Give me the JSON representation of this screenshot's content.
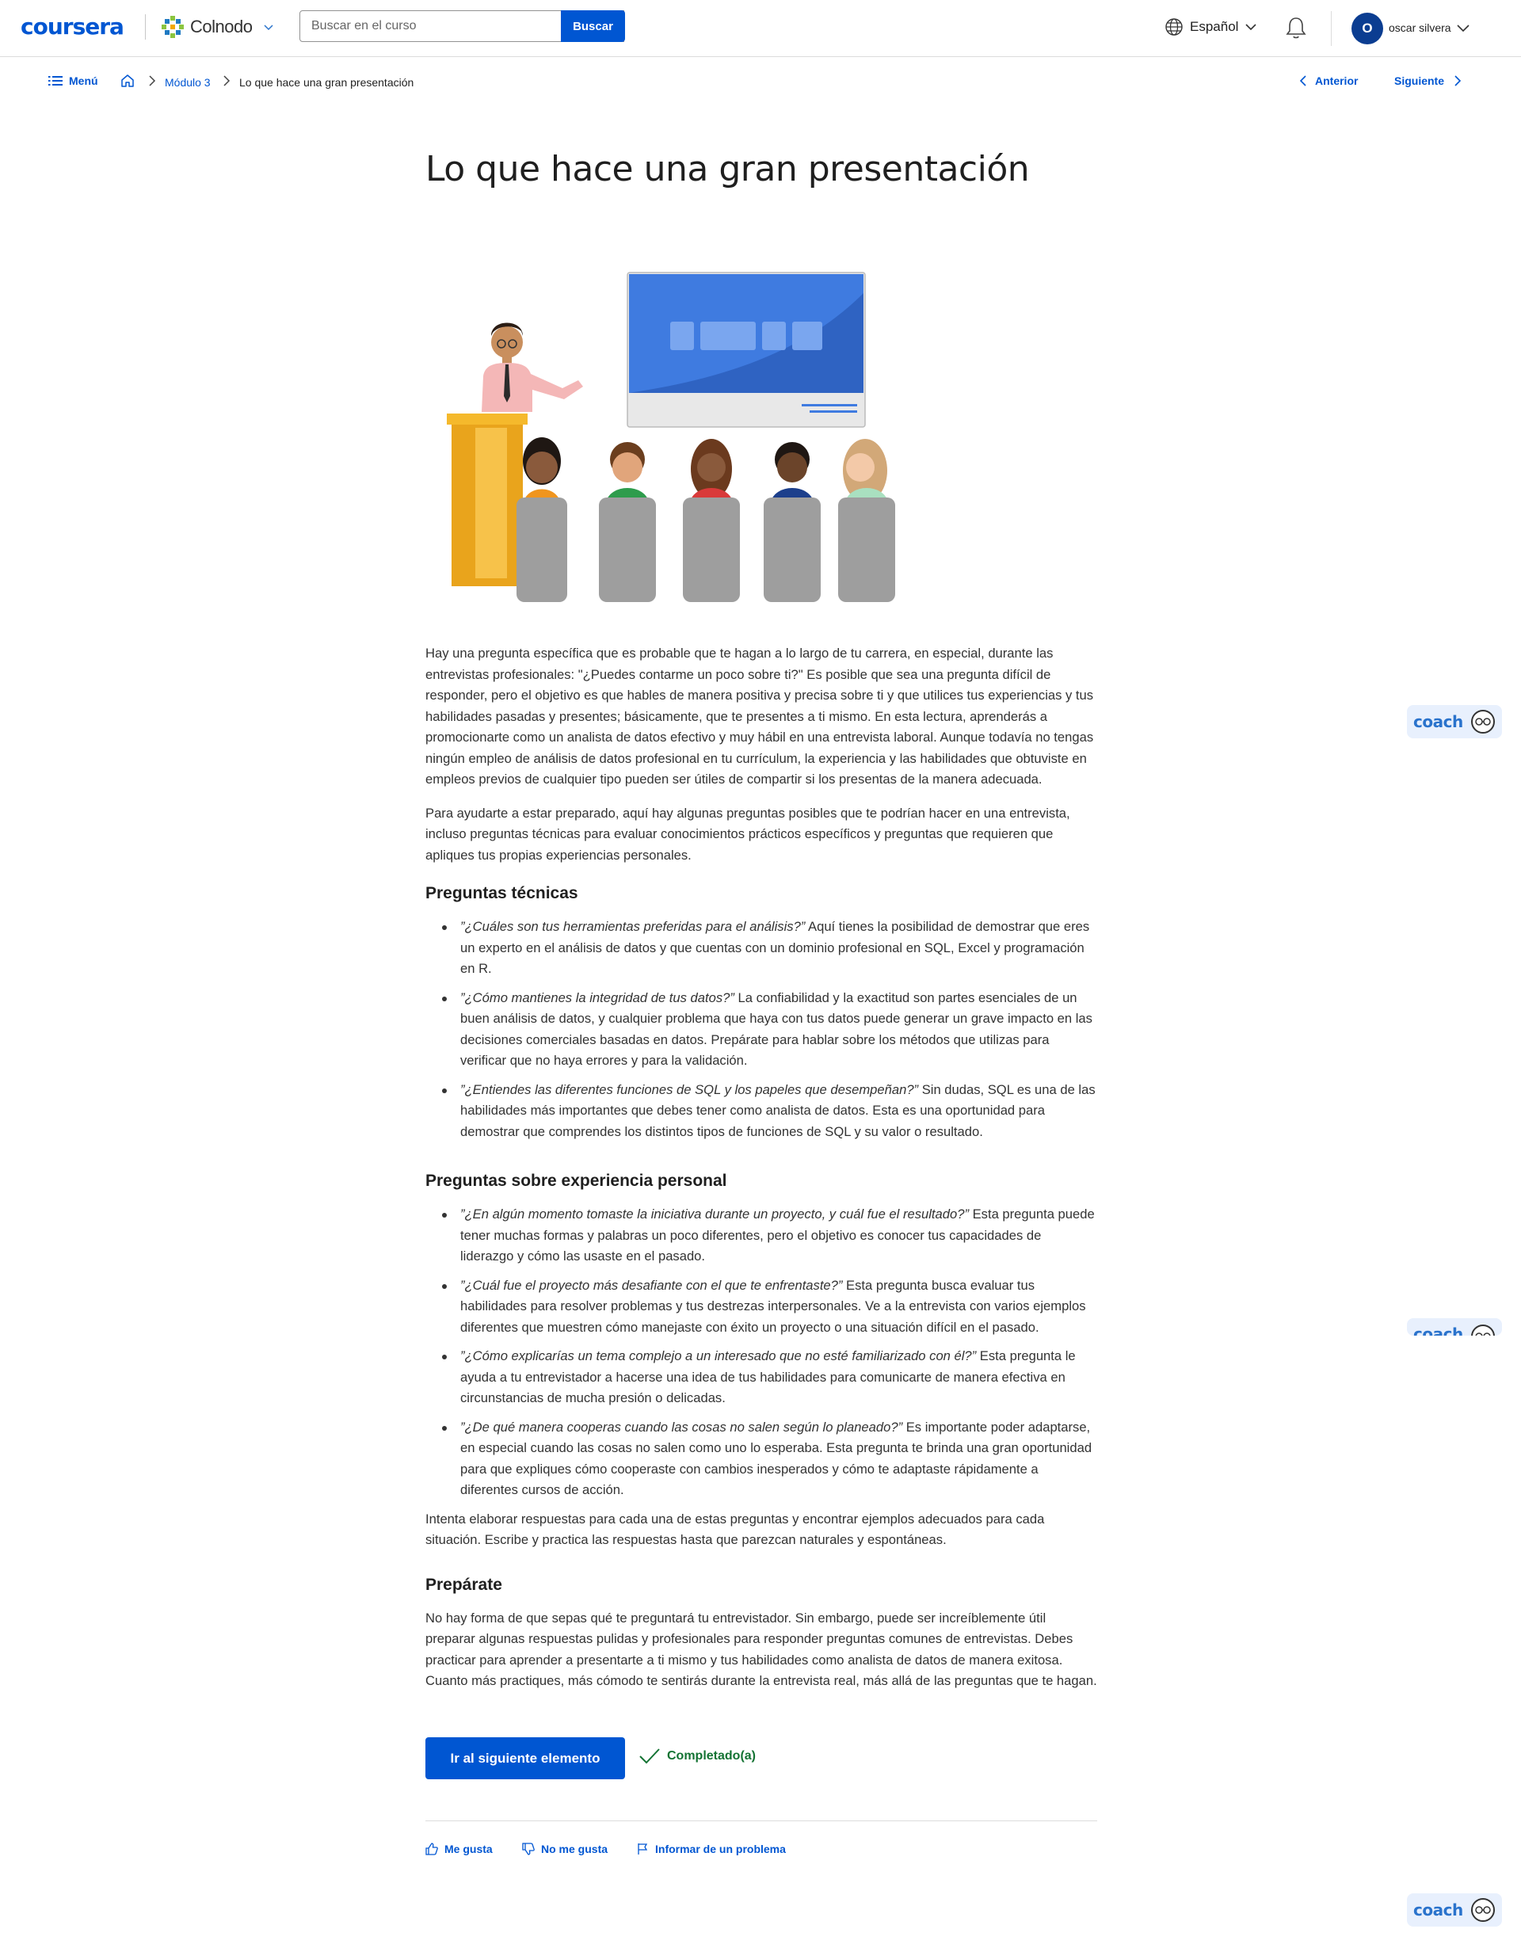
{
  "header": {
    "logo": "coursera",
    "partner": "Colnodo",
    "search_placeholder": "Buscar en el curso",
    "search_button": "Buscar",
    "language": "Español",
    "avatar_initial": "O",
    "username": "oscar silvera"
  },
  "breadcrumb": {
    "menu": "Menú",
    "module": "Módulo 3",
    "current": "Lo que hace una gran presentación",
    "prev": "Anterior",
    "next": "Siguiente"
  },
  "page": {
    "title": "Lo que hace una gran presentación",
    "intro_1": "Hay una pregunta específica que es probable que te hagan a lo largo de tu carrera, en especial, durante las entrevistas profesionales: \"¿Puedes contarme un poco sobre ti?\" Es posible que sea una pregunta difícil de responder, pero el objetivo es que hables de manera positiva y precisa sobre ti y que utilices tus experiencias y tus habilidades pasadas y presentes; básicamente, que te presentes a ti mismo. En esta lectura, aprenderás a promocionarte como un analista de datos efectivo y muy hábil en una entrevista laboral. Aunque todavía no tengas ningún empleo de análisis de datos profesional en tu currículum, la experiencia y las habilidades que obtuviste en empleos previos de cualquier tipo pueden ser útiles de compartir si los presentas de la manera adecuada.",
    "intro_2": "Para ayudarte a estar preparado, aquí hay algunas preguntas posibles que te podrían hacer en una entrevista, incluso preguntas técnicas para evaluar conocimientos prácticos específicos y preguntas que requieren que apliques tus propias experiencias personales.",
    "h_tech": "Preguntas técnicas",
    "tech": [
      {
        "q": "”¿Cuáles son tus herramientas preferidas para el análisis?”",
        "a": " Aquí tienes la posibilidad de demostrar que eres un experto en el análisis de datos y que cuentas con un dominio profesional en SQL, Excel y programación en R."
      },
      {
        "q": "”¿Cómo mantienes la integridad de tus datos?”",
        "a": " La confiabilidad y la exactitud son partes esenciales de un buen análisis de datos, y cualquier problema que haya con tus datos puede generar un grave impacto en las decisiones comerciales basadas en datos. Prepárate para hablar sobre los métodos que utilizas para verificar que no haya errores y para la validación."
      },
      {
        "q": "”¿Entiendes las diferentes funciones de SQL y los papeles que desempeñan?”",
        "a": " Sin dudas, SQL es una de las habilidades más importantes que debes tener como analista de datos. Esta es una oportunidad para demostrar que comprendes los distintos tipos de funciones de SQL y su valor o resultado."
      }
    ],
    "h_personal": "Preguntas sobre experiencia personal",
    "personal": [
      {
        "q": "”¿En algún momento tomaste la iniciativa durante un proyecto, y cuál fue el resultado?”",
        "a": " Esta pregunta puede tener muchas formas y palabras un poco diferentes, pero el objetivo es conocer tus capacidades de liderazgo y cómo las usaste en el pasado."
      },
      {
        "q": "”¿Cuál fue el proyecto más desafiante con el que te enfrentaste?”",
        "a": " Esta pregunta busca evaluar tus habilidades para resolver problemas y tus destrezas interpersonales. Ve a la entrevista con varios ejemplos diferentes que muestren cómo manejaste con éxito un proyecto o una situación difícil en el pasado."
      },
      {
        "q": "”¿Cómo explicarías un tema complejo a un interesado que no esté familiarizado con él?”",
        "a": " Esta pregunta le ayuda a tu entrevistador a hacerse una idea de tus habilidades para comunicarte de manera efectiva en circunstancias de mucha presión o delicadas."
      },
      {
        "q": "”¿De qué manera cooperas cuando las cosas no salen según lo planeado?”",
        "a": " Es importante poder adaptarse, en especial cuando las cosas no salen como uno lo esperaba. Esta pregunta te brinda una gran oportunidad para que expliques cómo cooperaste con cambios inesperados y cómo te adaptaste rápidamente a diferentes cursos de acción."
      }
    ],
    "closing": "Intenta elaborar respuestas para cada una de estas preguntas y encontrar ejemplos adecuados para cada situación. Escribe y practica las respuestas hasta que parezcan naturales y espontáneas.",
    "h_prep": "Prepárate",
    "prep": "No hay forma de que sepas qué te preguntará tu entrevistador. Sin embargo, puede ser increíblemente útil preparar algunas respuestas pulidas y profesionales para responder preguntas comunes de entrevistas. Debes practicar para aprender a presentarte a ti mismo y tus habilidades como analista de datos de manera exitosa. Cuanto más practiques, más cómodo te sentirás durante la entrevista real, más allá de las preguntas que te hagan."
  },
  "actions": {
    "next_item": "Ir al siguiente elemento",
    "completed": "Completado(a)",
    "like": "Me gusta",
    "dislike": "No me gusta",
    "report": "Informar de un problema"
  },
  "coach": {
    "label": "coach"
  },
  "colors": {
    "brand": "#0056d2",
    "success": "#137333"
  }
}
